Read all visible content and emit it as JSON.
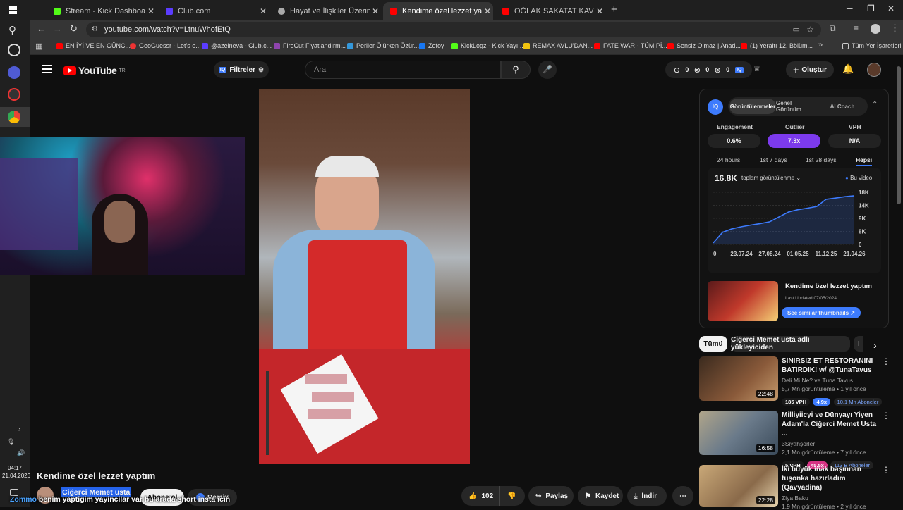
{
  "browser": {
    "tabs": [
      {
        "title": "Stream - Kick Dashboard",
        "color": "#53fc18"
      },
      {
        "title": "Club.com",
        "color": "#5b3cff"
      },
      {
        "title": "Hayat ve İlişkiler Üzerine",
        "color": "#aaaaaa"
      },
      {
        "title": "Kendime özel lezzet yaptım - Yo",
        "color": "#ff0000"
      },
      {
        "title": "OĞLAK SAKATAT KAVURMA - Yo",
        "color": "#ff0000"
      }
    ],
    "url": "youtube.com/watch?v=LtnuWhofEtQ",
    "bookmarks": [
      "EN İYİ VE EN GÜNC...",
      "GeoGuessr - Let's e...",
      "@azelneva - Club.c...",
      "FireCut Fiyatlandırm...",
      "Periler Ölürken Özür...",
      "Zefoy",
      "KickLogz - Kick Yayı...",
      "REMAX AVLU'DAN...",
      "FATE WAR - TÜM Pİ...",
      "Sensiz Olmaz | Anad...",
      "(1) Yeraltı 12. Bölüm...",
      "Tüm Yer İşaretleri"
    ]
  },
  "youtube": {
    "logo": "YouTube",
    "logo_sup": "TR",
    "filters_label": "Filtreler",
    "search_placeholder": "Ara",
    "header_counts": [
      "0",
      "0",
      "0"
    ],
    "create_label": "Oluştur",
    "video_title": "Kendime özel lezzet yaptım",
    "channel_name": "Ciğerci Memet usta",
    "subscribe_label": "Abone ol",
    "remix_label": "Remix",
    "like_count": "102",
    "share_label": "Paylaş",
    "save_label": "Kaydet",
    "download_label": "İndir",
    "overlay_caption": "benim yaptigim yayincilar var bu arada short insta icin",
    "overlay_user": "Zommo",
    "clock_time": "04:17",
    "clock_date": "21.04.2026"
  },
  "iq": {
    "tabs": [
      "Görüntülenmeler",
      "Genel Görünüm",
      "AI Coach"
    ],
    "metrics": [
      {
        "label": "Engagement",
        "value": "0.6%"
      },
      {
        "label": "Outlier",
        "value": "7.3x"
      },
      {
        "label": "VPH",
        "value": "N/A"
      }
    ],
    "ranges": [
      "24 hours",
      "1st 7 days",
      "1st 28 days",
      "Hepsi"
    ],
    "views_total": "16.8K",
    "views_dropdown": "toplam görüntülenme",
    "legend": "Bu video",
    "video_card_title": "Kendime özel lezzet yaptım",
    "video_card_updated": "Last Updated 07/05/2024",
    "similar_label": "See similar thumbnails"
  },
  "chart_data": {
    "type": "line",
    "x_ticks": [
      "0",
      "23.07.24",
      "27.08.24",
      "01.05.25",
      "11.12.25",
      "21.04.26"
    ],
    "y_ticks": [
      "0",
      "5K",
      "9K",
      "14K",
      "18K"
    ],
    "ylim": [
      0,
      18000
    ],
    "series": [
      {
        "name": "Bu video",
        "values": [
          500,
          4200,
          5400,
          6100,
          6700,
          7200,
          7800,
          9500,
          11200,
          12000,
          12500,
          13100,
          15600,
          16000,
          16500,
          16800
        ]
      }
    ]
  },
  "recommendations": {
    "chips": [
      "Tümü",
      "Ciğerci Memet usta adlı yükleyiciden",
      "İ"
    ],
    "items": [
      {
        "title": "SINIRSIZ ET RESTORANINI BATIRDIK! w/ @TunaTavus",
        "channel": "Deli Mi Ne?  ve Tuna Tavus",
        "meta": "5,7 Mn görüntüleme • 1 yıl önce",
        "duration": "22:48",
        "vph": "185 VPH",
        "outlier": "4.9x",
        "subs": "10,1 Mn Aboneler"
      },
      {
        "title": "Milliyiicyi ve Dünyayı Yiyen Adam'la Ciğerci Memet Usta ...",
        "channel": "3Siyahşörler",
        "meta": "2,1 Mn görüntüleme • 7 yıl önce",
        "duration": "16:58",
        "vph": "5 VPH",
        "outlier": "45.5x",
        "subs": "113 B Aboneler"
      },
      {
        "title": "İki büyük inak başınnan tuşonka hazırladım (Qavyadina)",
        "channel": "Ziya Baku",
        "meta": "1,9 Mn görüntüleme • 2 yıl önce",
        "duration": "22:28"
      }
    ]
  }
}
